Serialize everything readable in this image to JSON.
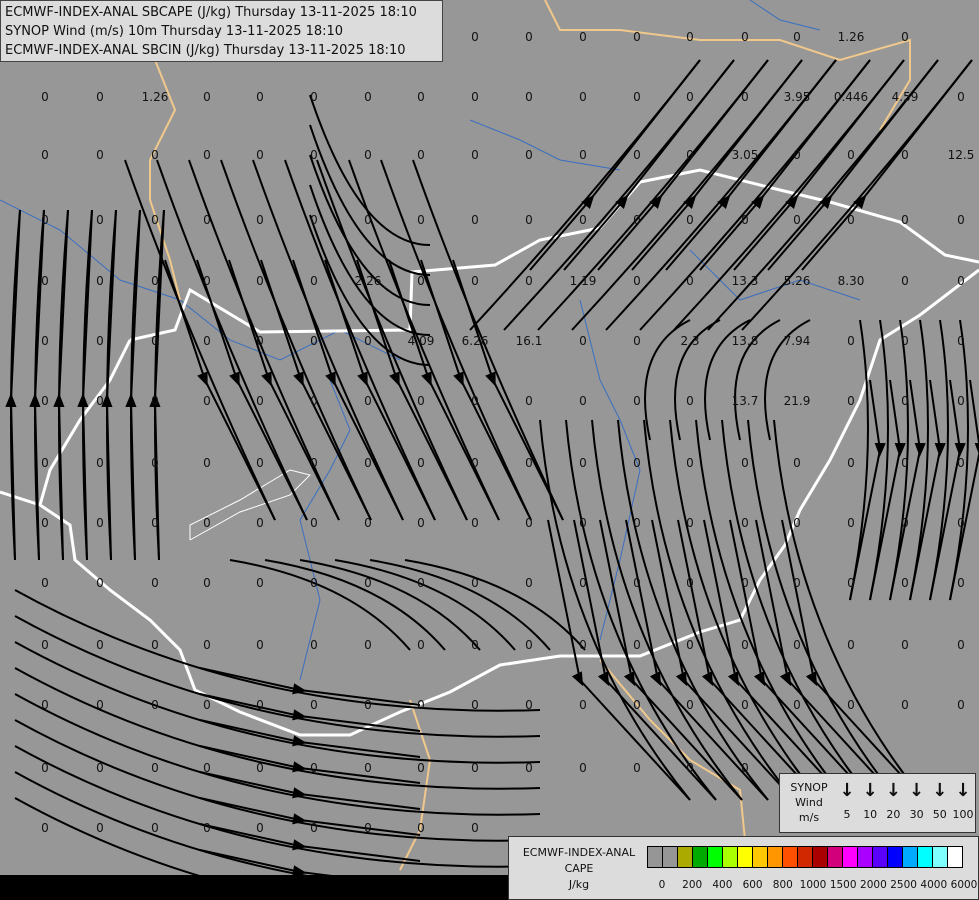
{
  "title": {
    "lines": [
      "ECMWF-INDEX-ANAL SBCAPE (J/kg) Thursday 13-11-2025 18:10",
      "SYNOP Wind (m/s) 10m Thursday 13-11-2025 18:10",
      "ECMWF-INDEX-ANAL SBCIN (J/kg) Thursday 13-11-2025 18:10"
    ]
  },
  "map": {
    "background_color": "#979797",
    "border_color": "#ffffff",
    "secondary_border_color": "#f0c88c",
    "river_color": "#3a6fc0",
    "streamline_color": "#000000",
    "cin_value_rows": [
      [
        "",
        "",
        "",
        "",
        "",
        "",
        "",
        "",
        "0",
        "0",
        "0",
        "0",
        "0",
        "0",
        "0",
        "1.26",
        "0",
        ""
      ],
      [
        "0",
        "0",
        "1.26",
        "0",
        "0",
        "0",
        "0",
        "0",
        "0",
        "0",
        "0",
        "0",
        "0",
        "0",
        "3.95",
        "0.446",
        "4.59",
        "0"
      ],
      [
        "0",
        "0",
        "0",
        "0",
        "0",
        "0",
        "0",
        "0",
        "0",
        "0",
        "0",
        "0",
        "0",
        "3.05",
        "0",
        "0",
        "0",
        "12.5"
      ],
      [
        "0",
        "0",
        "0",
        "0",
        "0",
        "0",
        "0",
        "0",
        "0",
        "0",
        "0",
        "0",
        "0",
        "0",
        "0",
        "0",
        "0",
        "0"
      ],
      [
        "0",
        "0",
        "0",
        "0",
        "0",
        "0",
        "2.26",
        "0",
        "0",
        "0",
        "1.19",
        "0",
        "0",
        "13.3",
        "5.26",
        "8.30",
        "0",
        "0"
      ],
      [
        "0",
        "0",
        "0",
        "0",
        "0",
        "0",
        "0",
        "4.09",
        "6.26",
        "16.1",
        "0",
        "0",
        "2.3",
        "13.8",
        "7.94",
        "0",
        "0",
        "0"
      ],
      [
        "0",
        "0",
        "0",
        "0",
        "0",
        "0",
        "0",
        "0",
        "0",
        "0",
        "0",
        "0",
        "0",
        "13.7",
        "21.9",
        "0",
        "0",
        "0"
      ],
      [
        "0",
        "0",
        "0",
        "0",
        "0",
        "0",
        "0",
        "0",
        "0",
        "0",
        "0",
        "0",
        "0",
        "0",
        "0",
        "0",
        "0",
        "0"
      ],
      [
        "0",
        "0",
        "0",
        "0",
        "0",
        "0",
        "0",
        "0",
        "0",
        "0",
        "0",
        "0",
        "0",
        "0",
        "0",
        "0",
        "0",
        "0"
      ],
      [
        "0",
        "0",
        "0",
        "0",
        "0",
        "0",
        "0",
        "0",
        "0",
        "0",
        "0",
        "0",
        "0",
        "0",
        "0",
        "0",
        "0",
        "0"
      ],
      [
        "0",
        "0",
        "0",
        "0",
        "0",
        "0",
        "0",
        "0",
        "0",
        "0",
        "0",
        "0",
        "0",
        "0",
        "0",
        "0",
        "0",
        "0"
      ],
      [
        "0",
        "0",
        "0",
        "0",
        "0",
        "0",
        "0",
        "0",
        "0",
        "0",
        "0",
        "0",
        "0",
        "0",
        "0",
        "0",
        "0",
        "0"
      ],
      [
        "0",
        "0",
        "0",
        "0",
        "0",
        "0",
        "0",
        "0",
        "0",
        "0",
        "0",
        "0",
        "0",
        "0",
        "",
        "",
        "",
        ""
      ],
      [
        "0",
        "0",
        "0",
        "0",
        "0",
        "0",
        "0",
        "0",
        "0",
        "",
        "",
        "",
        "",
        "",
        "",
        "",
        "",
        ""
      ]
    ]
  },
  "synop_legend": {
    "label_lines": [
      "SYNOP",
      "Wind",
      "m/s"
    ],
    "speeds": [
      "5",
      "10",
      "20",
      "30",
      "50",
      "100"
    ]
  },
  "cape_legend": {
    "label_lines": [
      "ECMWF-INDEX-ANAL",
      "CAPE",
      "J/kg"
    ],
    "colors": [
      "#969696",
      "#969696",
      "#aaaa00",
      "#00aa00",
      "#00ff00",
      "#aaff00",
      "#ffff00",
      "#ffc800",
      "#ff9600",
      "#ff5000",
      "#d22800",
      "#aa0000",
      "#d2007a",
      "#ff00ff",
      "#aa00ff",
      "#5a00ff",
      "#0000ff",
      "#00aaff",
      "#00ffff",
      "#80ffff",
      "#ffffff"
    ],
    "ticks": [
      "0",
      "200",
      "400",
      "600",
      "800",
      "1000",
      "1500",
      "2000",
      "2500",
      "4000",
      "6000"
    ]
  }
}
